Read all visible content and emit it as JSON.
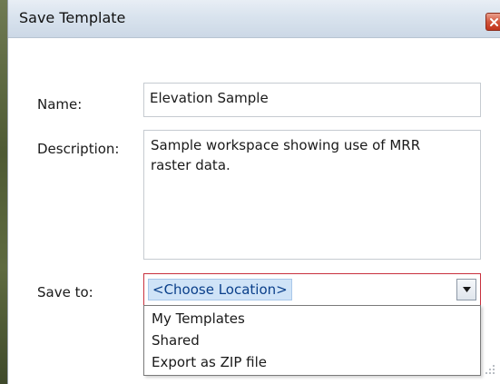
{
  "dialog": {
    "title": "Save Template",
    "close_icon": "close-icon"
  },
  "form": {
    "name_label": "Name:",
    "name_value": "Elevation Sample",
    "description_label": "Description:",
    "description_value": "Sample workspace showing use of MRR raster data.",
    "save_to_label": "Save to:",
    "save_to_value": "<Choose Location>",
    "save_to_options": [
      "My Templates",
      "Shared",
      "Export as ZIP file"
    ]
  },
  "colors": {
    "titlebar": "#d9e3ee",
    "close_button": "#d2553c",
    "combo_focus_border": "#c8313e",
    "selection_highlight": "#cfe3f7"
  }
}
